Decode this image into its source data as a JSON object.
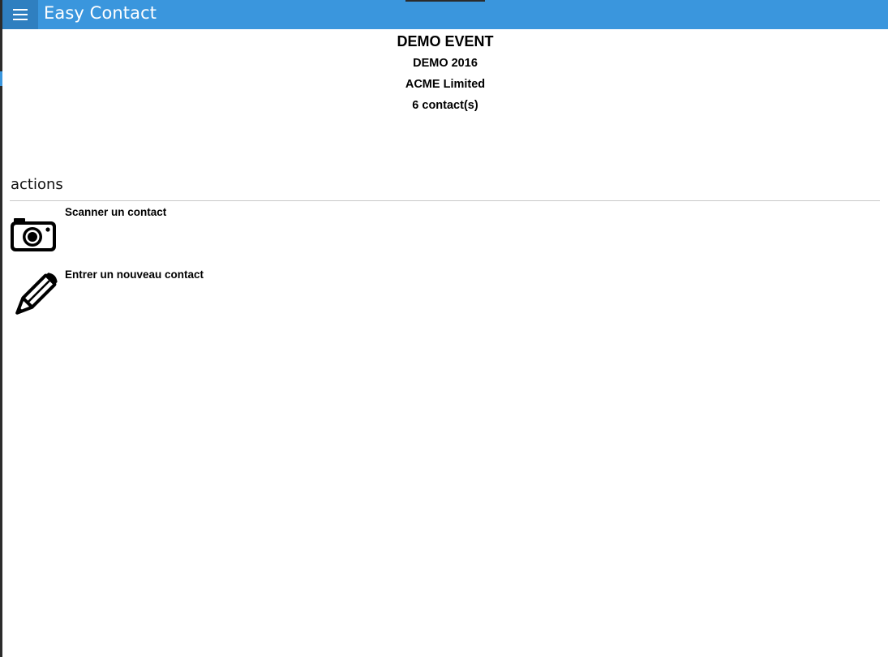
{
  "app": {
    "title": "Easy Contact",
    "accent_color": "#3a96dd",
    "menu_icon": "hamburger-menu-icon"
  },
  "event": {
    "name": "DEMO EVENT",
    "edition": "DEMO 2016",
    "company": "ACME Limited",
    "contact_count": "6 contact(s)"
  },
  "actions": {
    "header": "actions",
    "items": [
      {
        "label": "Scanner un contact",
        "icon": "camera-icon"
      },
      {
        "label": "Entrer un nouveau contact",
        "icon": "pencil-icon"
      }
    ]
  }
}
